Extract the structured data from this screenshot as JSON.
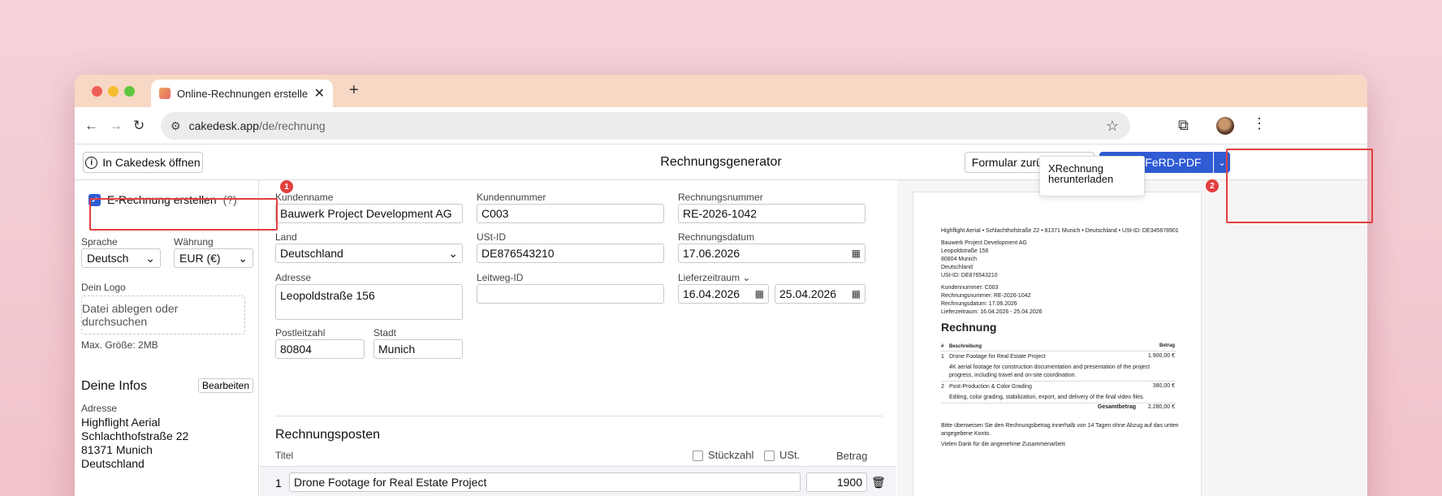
{
  "browser": {
    "tab_title": "Online-Rechnungen erstellen",
    "url_host": "cakedesk.app",
    "url_path": "/de/rechnung"
  },
  "header": {
    "open_button": "In Cakedesk öffnen",
    "title": "Rechnungsgenerator",
    "reset_button": "Formular zurücksetzen",
    "download_button": "ZUGFeRD-PDF",
    "dropdown_item": "XRechnung herunterladen"
  },
  "badges": {
    "one": "1",
    "two": "2"
  },
  "sidebar": {
    "erechnung_label": "E-Rechnung erstellen",
    "erechnung_help": "(?)",
    "language_label": "Sprache",
    "language_value": "Deutsch",
    "currency_label": "Währung",
    "currency_value": "EUR (€)",
    "logo_label": "Dein Logo",
    "logo_drop": "Datei ablegen oder durchsuchen",
    "logo_max": "Max. Größe: 2MB",
    "info_title": "Deine Infos",
    "edit_button": "Bearbeiten",
    "address_label": "Adresse",
    "address_lines": [
      "Highflight Aerial",
      "Schlachthofstraße 22",
      "81371 Munich",
      "Deutschland"
    ]
  },
  "form": {
    "customer_name_label": "Kundenname",
    "customer_name": "Bauwerk Project Development AG",
    "customer_number_label": "Kundennummer",
    "customer_number": "C003",
    "invoice_number_label": "Rechnungsnummer",
    "invoice_number": "RE-2026-1042",
    "country_label": "Land",
    "country": "Deutschland",
    "vat_label": "USt-ID",
    "vat": "DE876543210",
    "invoice_date_label": "Rechnungsdatum",
    "invoice_date": "17.06.2026",
    "address_label": "Adresse",
    "address": "Leopoldstraße 156",
    "leitweg_label": "Leitweg-ID",
    "leitweg": "",
    "delivery_label": "Lieferzeitraum",
    "delivery_from": "16.04.2026",
    "delivery_to": "25.04.2026",
    "zip_label": "Postleitzahl",
    "zip": "80804",
    "city_label": "Stadt",
    "city": "Munich",
    "items_title": "Rechnungsposten",
    "col_title": "Titel",
    "col_qty": "Stückzahl",
    "col_vat": "USt.",
    "col_amount": "Betrag",
    "item_index": "1",
    "item_title": "Drone Footage for Real Estate Project",
    "item_amount": "1900"
  },
  "preview": {
    "sender": "Highflight Aerial • Schlachthofstraße 22 • 81371 Munich • Deutschland • USt-ID: DE345678901",
    "recipient": [
      "Bauwerk Project Development AG",
      "Leopoldstraße 156",
      "80804 Munich",
      "Deutschland",
      "USt-ID: DE876543210"
    ],
    "meta": [
      "Kundennummer: C003",
      "Rechnungsnummer: RE-2026-1042",
      "Rechnungsdatum: 17.06.2026",
      "Lieferzeitraum: 16.04.2026 - 25.04.2026"
    ],
    "heading": "Rechnung",
    "th_num": "#",
    "th_desc": "Beschreibung",
    "th_amount": "Betrag",
    "item1_num": "1",
    "item1_title": "Drone Footage for Real Estate Project",
    "item1_amount": "1.900,00 €",
    "item1_desc1": "4K aerial footage for construction documentation and presentation of the project",
    "item1_desc2": "progress, including travel and on-site coordination.",
    "item2_num": "2",
    "item2_title": "Post-Production & Color Grading",
    "item2_amount": "380,00 €",
    "item2_desc": "Editing, color grading, stabilization, export, and delivery of the final video files.",
    "total_label": "Gesamtbetrag",
    "total": "2.280,00 €",
    "note1": "Bitte überweisen Sie den Rechnungsbetrag innerhalb von 14 Tagen ohne Abzug auf das unten",
    "note2": "angegebene Konto.",
    "thanks": "Vielen Dank für die angenehme Zusammenarbeit."
  },
  "colors": {
    "accent": "#2f5bd3",
    "highlight": "#e33f3f"
  }
}
